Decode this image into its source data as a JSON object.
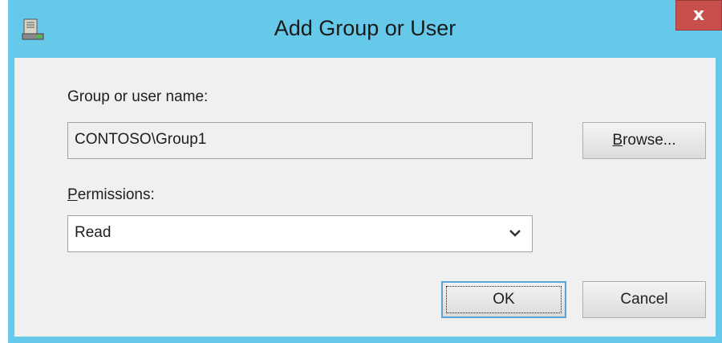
{
  "window": {
    "title": "Add Group or User",
    "title_icon": "server-icon",
    "close_glyph": "x",
    "colors": {
      "titlebar": "#66c9ea",
      "close": "#c7504c",
      "client": "#f0f0f0"
    }
  },
  "form": {
    "name_label_prefix": "Group or user name:",
    "name_value": "CONTOSO\\Group1",
    "browse_accel": "B",
    "browse_rest": "rowse...",
    "perm_label_accel": "P",
    "perm_label_rest": "ermissions:",
    "perm_selected": "Read",
    "perm_arrow_icon": "chevron-down-icon"
  },
  "buttons": {
    "ok": "OK",
    "cancel": "Cancel"
  }
}
